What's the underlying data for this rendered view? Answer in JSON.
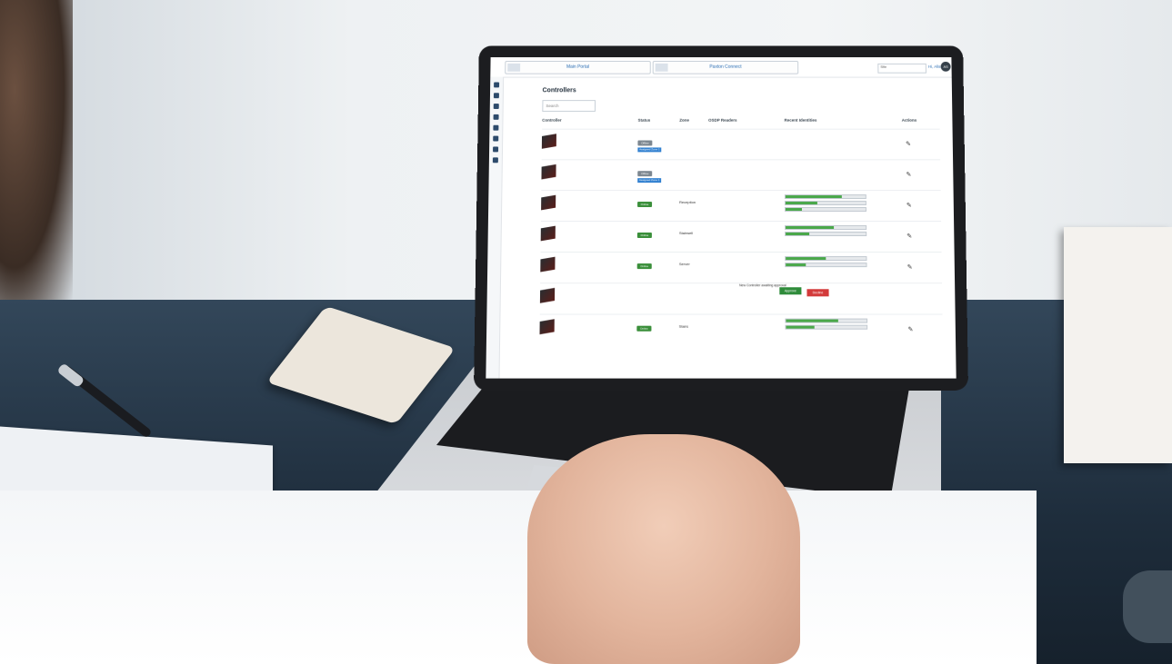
{
  "screen": {
    "nav": {
      "tile1": "Main Portal",
      "tile2": "Paxton Connect"
    },
    "select_value": "Site",
    "user_menu": "Hi, Alison",
    "avatar_initials": "AS",
    "page_title": "Controllers",
    "search_placeholder": "Search",
    "columns": [
      "Controller",
      "Status",
      "Zone",
      "OSDP Readers",
      "Recent Identities",
      "Actions"
    ],
    "badges": {
      "offline": "Offline",
      "online": "Online",
      "assigned": "Assigned Zone 1"
    },
    "pending_text": "New Controller awaiting approval",
    "approve_label": "Approve",
    "decline_label": "Decline",
    "zones": [
      "Reception",
      "Stairwell",
      "Server",
      "Stairs"
    ]
  }
}
